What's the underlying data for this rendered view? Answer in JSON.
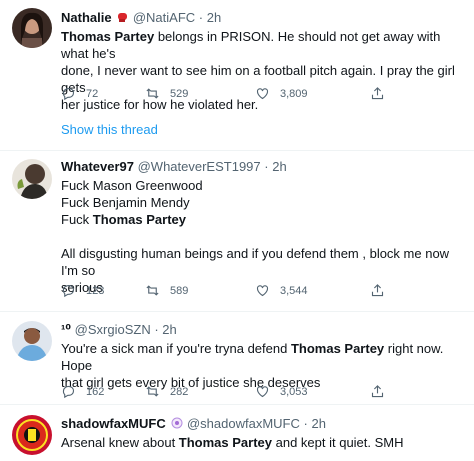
{
  "tweets": [
    {
      "name": "Nathalie",
      "name_emoji": "boxing-glove-icon",
      "handle": "@NatiAFC",
      "dot": "·",
      "time": "2h",
      "text_parts": [
        {
          "b": "Thomas Partey"
        },
        {
          "t": " belongs in PRISON. He should not get away with what he's"
        }
      ],
      "text_line2": "done, I never want to see him on a football pitch again. I pray the girl gets",
      "text_line3": "her justice for how he violated her.",
      "replies": "72",
      "retweets": "529",
      "likes": "3,809",
      "show_thread": "Show this thread"
    },
    {
      "name": "Whatever97",
      "handle": "@WhateverEST1997",
      "dot": "·",
      "time": "2h",
      "line1": "Fuck Mason Greenwood",
      "line2": "Fuck Benjamin Mendy",
      "line3_pre": "Fuck ",
      "line3_b": "Thomas Partey",
      "line4": "All disgusting human beings and if you defend them , block me now I'm so",
      "line5": "serious",
      "replies": "123",
      "retweets": "589",
      "likes": "3,544"
    },
    {
      "name": "¹⁰",
      "handle": "@SxrgioSZN",
      "dot": "·",
      "time": "2h",
      "line1_pre": "You're a sick man if you're tryna defend ",
      "line1_b": "Thomas Partey",
      "line1_post": " right now. Hope",
      "line2": "that girl gets every bit of justice she deserves",
      "replies": "162",
      "retweets": "282",
      "likes": "3,053"
    },
    {
      "name": "shadowfaxMUFC",
      "handle": "@shadowfaxMUFC",
      "dot": "·",
      "time": "2h",
      "line1_pre": "Arsenal knew about ",
      "line1_b": "Thomas Partey",
      "line1_post": " and kept it quiet. SMH"
    }
  ],
  "colors": {
    "accent": "#1d9bf0",
    "muted": "#536471",
    "divider": "#eff3f4"
  }
}
